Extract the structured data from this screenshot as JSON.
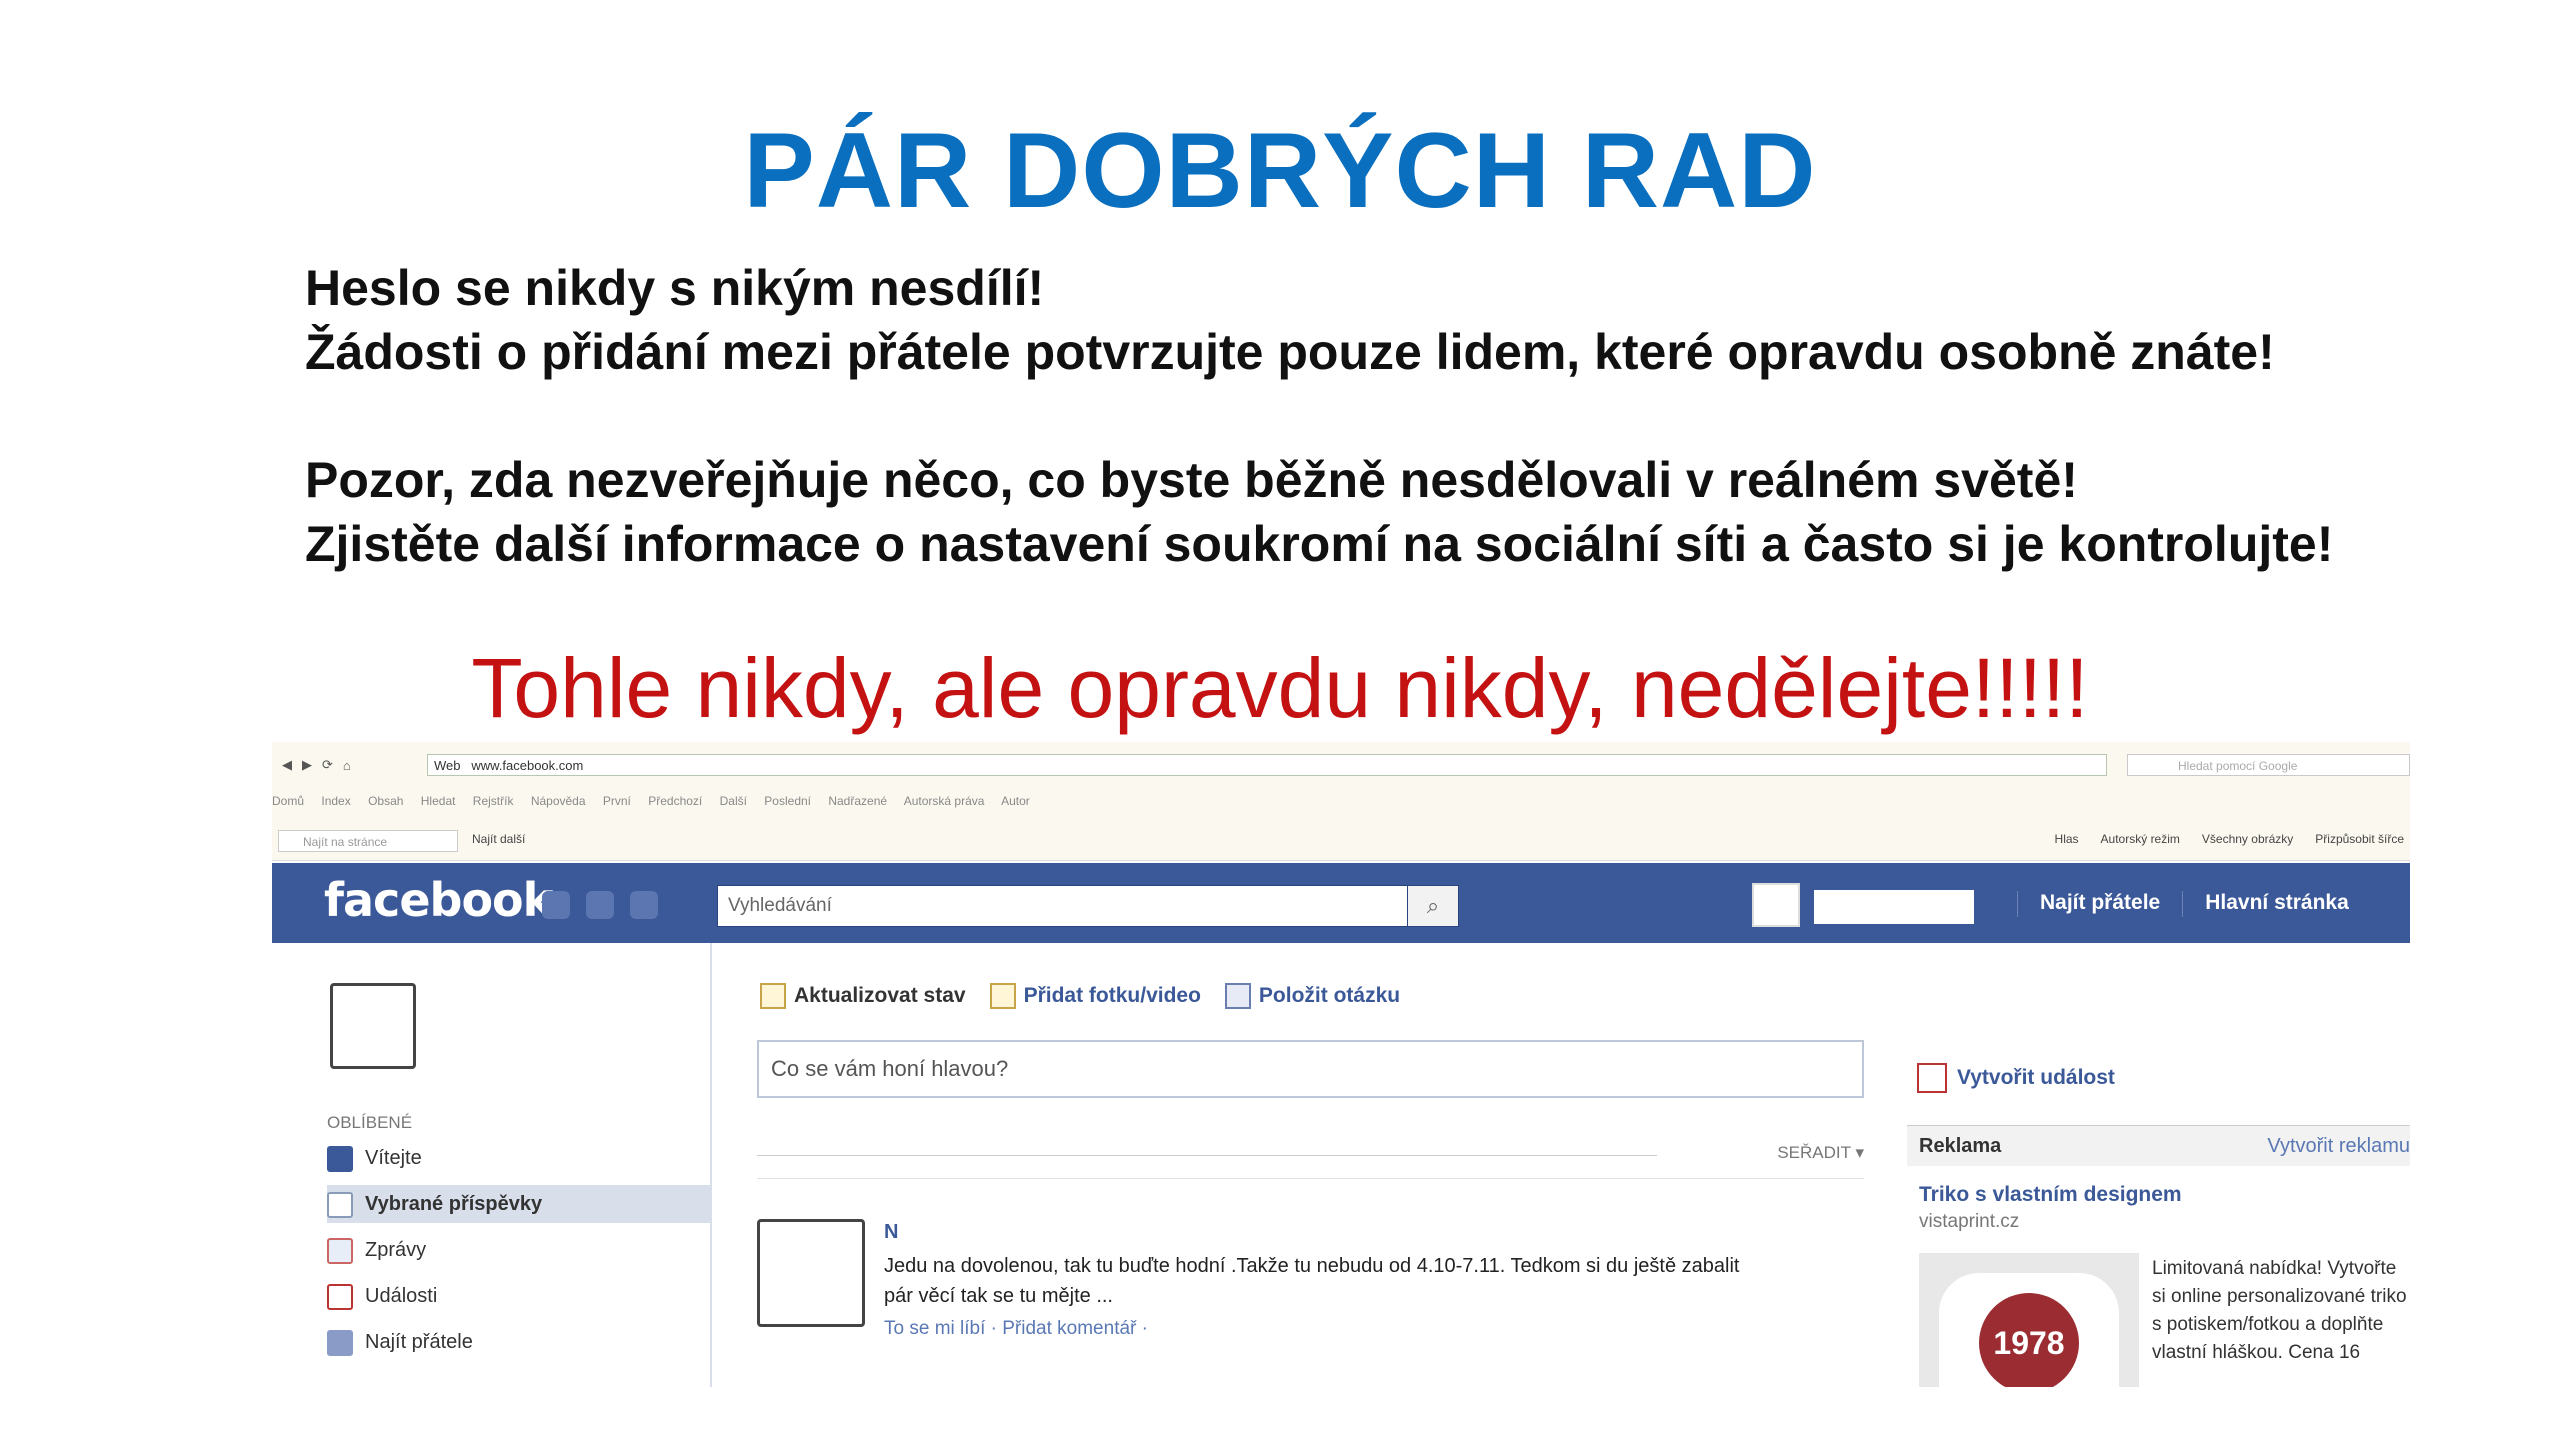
{
  "slide": {
    "title": "PÁR DOBRÝCH RAD",
    "line1": "Heslo se nikdy s nikým nesdílí!",
    "line2": "Žádosti o přidání mezi přátele potvrzujte pouze lidem, které opravdu osobně znáte!",
    "line3": "Pozor, zda nezveřejňuje něco, co byste běžně nesdělovali v reálném světě!",
    "line4": "Zjistěte další informace o nastavení soukromí na sociální síti a často si je kontrolujte!",
    "warning": "Tohle nikdy, ale opravdu nikdy, nedělejte!!!!!"
  },
  "browser": {
    "url_label": "Web",
    "url": "www.facebook.com",
    "google_placeholder": "Hledat pomocí Google",
    "menu_items": [
      "Domů",
      "Index",
      "Obsah",
      "Hledat",
      "Rejstřík",
      "Nápověda",
      "První",
      "Předchozí",
      "Další",
      "Poslední",
      "Nadřazené",
      "Autorská práva",
      "Autor"
    ],
    "find_placeholder": "Najít na stránce",
    "find_next": "Najít další",
    "right_links": [
      "Hlas",
      "Autorský režim",
      "Všechny obrázky",
      "Přizpůsobit šířce"
    ]
  },
  "facebook": {
    "logo": "facebook",
    "search_placeholder": "Vyhledávání",
    "nav_find_friends": "Najít přátele",
    "nav_home": "Hlavní stránka",
    "favorites_heading": "OBLÍBENÉ",
    "nav_items": [
      {
        "label": "Vítejte"
      },
      {
        "label": "Vybrané příspěvky"
      },
      {
        "label": "Zprávy"
      },
      {
        "label": "Události"
      },
      {
        "label": "Najít přátele"
      }
    ],
    "tabs": {
      "update_status": "Aktualizovat stav",
      "add_photo": "Přidat fotku/video",
      "ask_question": "Položit otázku"
    },
    "status_placeholder": "Co se vám honí hlavou?",
    "sort_label": "SEŘADIT",
    "post": {
      "author": "N",
      "text": "Jedu na dovolenou, tak tu buďte hodní .Takže tu nebudu od 4.10-7.11. Tedkom si du ještě zabalit pár věcí tak se tu mějte ...",
      "actions": "To se mi líbí · Přidat komentář ·"
    },
    "create_event": "Vytvořit událost",
    "ad_heading": "Reklama",
    "ad_create": "Vytvořit reklamu",
    "ad_title": "Triko s vlastním designem",
    "ad_url": "vistaprint.cz",
    "ad_badge": "1978",
    "ad_text": "Limitovaná nabídka! Vytvořte si online personalizované triko s potiskem/fotkou a doplňte vlastní hláškou. Cena 16"
  },
  "colors": {
    "title_blue": "#0a6fbf",
    "warning_red": "#c41212",
    "facebook_blue": "#3b5998"
  }
}
